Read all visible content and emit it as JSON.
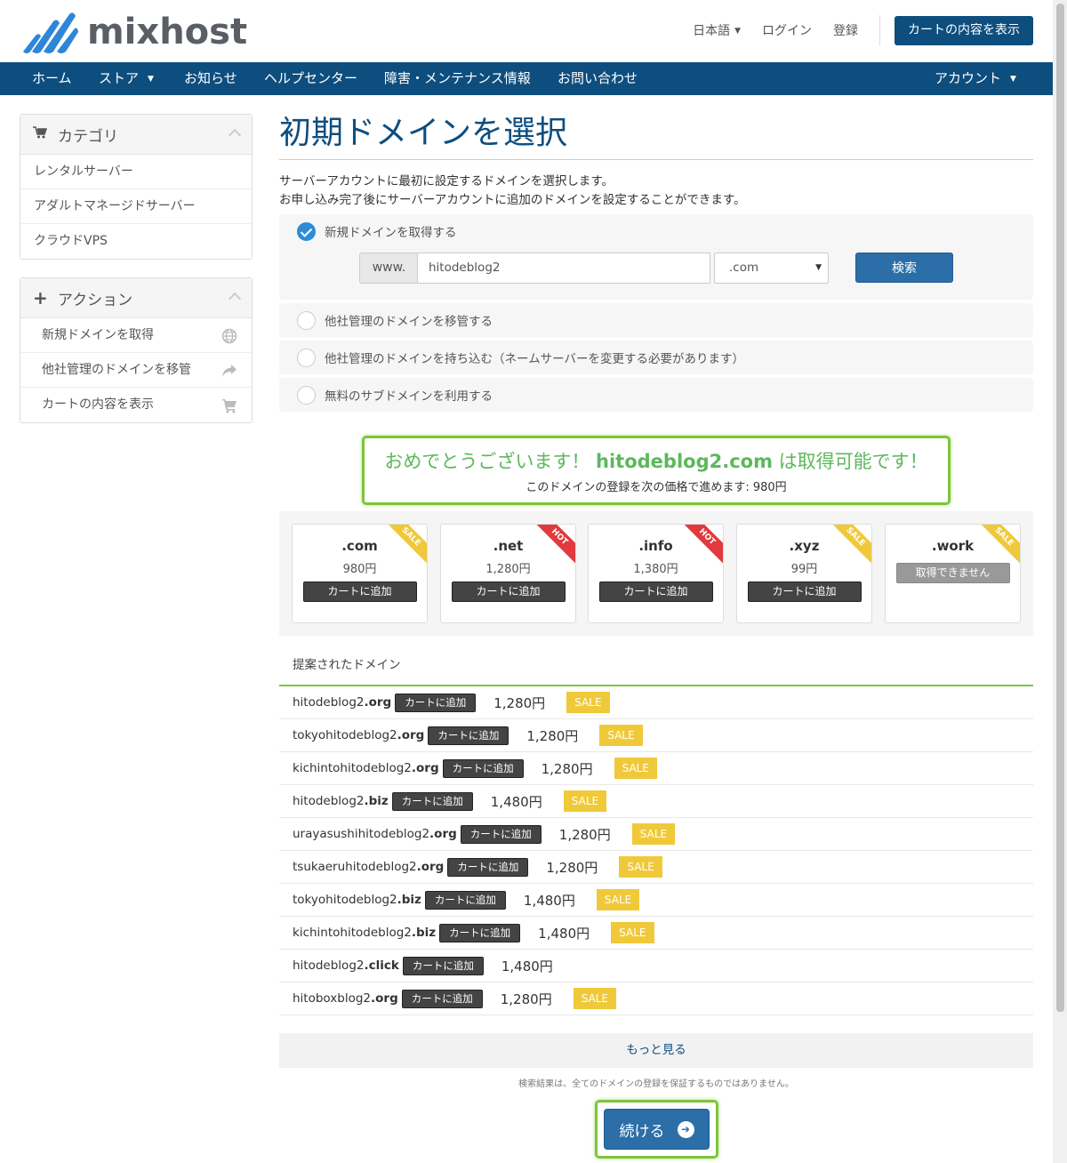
{
  "header": {
    "logo_text": "mixhost",
    "language": "日本語",
    "login": "ログイン",
    "register": "登録",
    "view_cart": "カートの内容を表示"
  },
  "nav": {
    "home": "ホーム",
    "store": "ストア",
    "news": "お知らせ",
    "help": "ヘルプセンター",
    "maintenance": "障害・メンテナンス情報",
    "contact": "お問い合わせ",
    "account": "アカウント"
  },
  "sidebar": {
    "category_title": "カテゴリ",
    "categories": [
      "レンタルサーバー",
      "アダルトマネージドサーバー",
      "クラウドVPS"
    ],
    "action_title": "アクション",
    "actions": [
      "新規ドメインを取得",
      "他社管理のドメインを移管",
      "カートの内容を表示"
    ]
  },
  "main": {
    "title": "初期ドメインを選択",
    "desc1": "サーバーアカウントに最初に設定するドメインを選択します。",
    "desc2": "お申し込み完了後にサーバーアカウントに追加のドメインを設定することができます。",
    "options": [
      "新規ドメインを取得する",
      "他社管理のドメインを移管する",
      "他社管理のドメインを持ち込む（ネームサーバーを変更する必要があります）",
      "無料のサブドメインを利用する"
    ],
    "www_prefix": "www.",
    "domain_value": "hitodeblog2",
    "tld_selected": ".com",
    "search_button": "検索"
  },
  "congrats": {
    "prefix": "おめでとうございます！",
    "domain": "hitodeblog2.com",
    "suffix": "は取得可能です！",
    "sub": "このドメインの登録を次の価格で進めます: 980円"
  },
  "tlds": [
    {
      "name": ".com",
      "price": "980円",
      "badge": "SALE",
      "badge_type": "sale",
      "button": "カートに追加"
    },
    {
      "name": ".net",
      "price": "1,280円",
      "badge": "HOT",
      "badge_type": "hot",
      "button": "カートに追加"
    },
    {
      "name": ".info",
      "price": "1,380円",
      "badge": "HOT",
      "badge_type": "hot",
      "button": "カートに追加"
    },
    {
      "name": ".xyz",
      "price": "99円",
      "badge": "SALE",
      "badge_type": "sale",
      "button": "カートに追加"
    },
    {
      "name": ".work",
      "price": "",
      "badge": "SALE",
      "badge_type": "sale",
      "button": "取得できません"
    }
  ],
  "suggestions": {
    "title": "提案されたドメイン",
    "add_label": "カートに追加",
    "sale_label": "SALE",
    "rows": [
      {
        "base": "hitodeblog2",
        "tld": ".org",
        "price": "1,280円",
        "sale": true
      },
      {
        "base": "tokyohitodeblog2",
        "tld": ".org",
        "price": "1,280円",
        "sale": true
      },
      {
        "base": "kichintohitodeblog2",
        "tld": ".org",
        "price": "1,280円",
        "sale": true
      },
      {
        "base": "hitodeblog2",
        "tld": ".biz",
        "price": "1,480円",
        "sale": true
      },
      {
        "base": "urayasushihitodeblog2",
        "tld": ".org",
        "price": "1,280円",
        "sale": true
      },
      {
        "base": "tsukaeruhitodeblog2",
        "tld": ".org",
        "price": "1,280円",
        "sale": true
      },
      {
        "base": "tokyohitodeblog2",
        "tld": ".biz",
        "price": "1,480円",
        "sale": true
      },
      {
        "base": "kichintohitodeblog2",
        "tld": ".biz",
        "price": "1,480円",
        "sale": true
      },
      {
        "base": "hitodeblog2",
        "tld": ".click",
        "price": "1,480円",
        "sale": false
      },
      {
        "base": "hitoboxblog2",
        "tld": ".org",
        "price": "1,280円",
        "sale": true
      }
    ],
    "more": "もっと見る",
    "note": "検索結果は、全てのドメインの登録を保証するものではありません。"
  },
  "continue_button": "続ける",
  "colors": {
    "brand": "#0e4e7e",
    "primary_button": "#2b6ea8",
    "highlight": "#7ec53b",
    "sale": "#f0c93a",
    "hot": "#e0393e"
  }
}
